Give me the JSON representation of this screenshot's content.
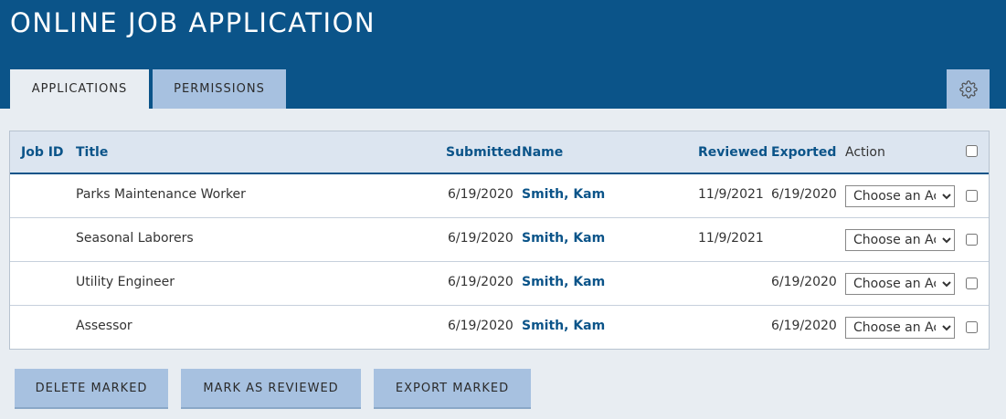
{
  "header": {
    "title": "ONLINE JOB APPLICATION"
  },
  "tabs": [
    {
      "label": "APPLICATIONS",
      "active": true
    },
    {
      "label": "PERMISSIONS",
      "active": false
    }
  ],
  "settings": {
    "icon": "gear-icon"
  },
  "table": {
    "columns": {
      "job_id": "Job ID",
      "title": "Title",
      "submitted": "Submitted",
      "name": "Name",
      "reviewed": "Reviewed",
      "exported": "Exported",
      "action": "Action"
    },
    "action_placeholder": "Choose an Action",
    "rows": [
      {
        "job_id": "",
        "title": "Parks Maintenance Worker",
        "submitted": "6/19/2020",
        "name": "Smith, Kam",
        "reviewed": "11/9/2021",
        "exported": "6/19/2020"
      },
      {
        "job_id": "",
        "title": "Seasonal Laborers",
        "submitted": "6/19/2020",
        "name": "Smith, Kam",
        "reviewed": "11/9/2021",
        "exported": ""
      },
      {
        "job_id": "",
        "title": "Utility Engineer",
        "submitted": "6/19/2020",
        "name": "Smith, Kam",
        "reviewed": "",
        "exported": "6/19/2020"
      },
      {
        "job_id": "",
        "title": "Assessor",
        "submitted": "6/19/2020",
        "name": "Smith, Kam",
        "reviewed": "",
        "exported": "6/19/2020"
      }
    ]
  },
  "footer": {
    "delete_label": "DELETE MARKED",
    "review_label": "MARK AS REVIEWED",
    "export_label": "EXPORT MARKED"
  },
  "colors": {
    "header_bg": "#0b5489",
    "tab_inactive_bg": "#a7c1e0",
    "page_bg": "#e8edf2",
    "link_text": "#0b5489"
  }
}
